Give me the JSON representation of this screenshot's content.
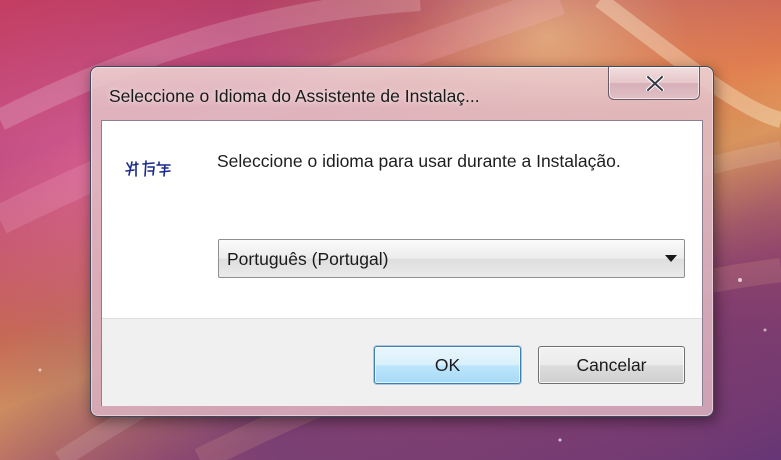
{
  "window": {
    "title": "Seleccione o Idioma do Assistente de Instalaç...",
    "close_label": "close"
  },
  "dialog": {
    "instruction": "Seleccione o idioma para usar durante a Instalação.",
    "language_select": {
      "selected": "Português (Portugal)"
    },
    "ok_label": "OK",
    "cancel_label": "Cancelar"
  },
  "icons": {
    "close": "close-icon",
    "dropdown": "chevron-down-icon",
    "logo": "setup-logo-icon"
  },
  "colors": {
    "ok_accent": "#3c7fb1",
    "logo_color": "#1a2a8a"
  }
}
